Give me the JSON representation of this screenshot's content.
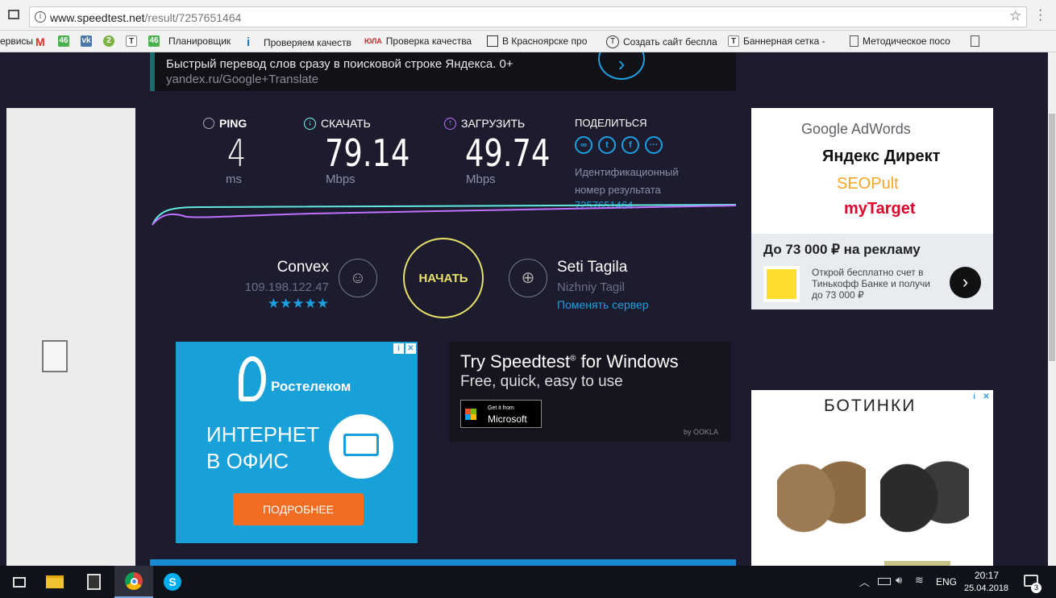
{
  "browser": {
    "url_host": "www.speedtest.net",
    "url_path": "/result/7257651464",
    "bookmarks": [
      {
        "label": "ервисы",
        "icon": "apps-icon"
      },
      {
        "label": "",
        "icon": "gmail-icon"
      },
      {
        "label": "",
        "icon": "badge-46-icon"
      },
      {
        "label": "",
        "icon": "vk-icon"
      },
      {
        "label": "",
        "icon": "2gis-icon"
      },
      {
        "label": "",
        "icon": "t-icon"
      },
      {
        "label": "",
        "icon": "badge-46-icon"
      },
      {
        "label": "Планировщик",
        "icon": ""
      },
      {
        "label": "Проверяем качеств",
        "icon": "info-icon"
      },
      {
        "label": "Проверка качества",
        "icon": "logo-icon"
      },
      {
        "label": "В Красноярске про",
        "icon": "doc-icon"
      },
      {
        "label": "Создать сайт беспла",
        "icon": "t-circle-icon"
      },
      {
        "label": "Баннерная сетка - ",
        "icon": "t-icon"
      },
      {
        "label": "Методическое посо",
        "icon": "page-icon"
      }
    ]
  },
  "top_ad": {
    "title": "Быстрый перевод слов сразу в поисковой строке Яндекса. 0+",
    "url": "yandex.ru/Google+Translate"
  },
  "results": {
    "ping": {
      "label": "PING",
      "value": "4",
      "unit": "ms"
    },
    "download": {
      "label": "СКАЧАТЬ",
      "value": "79.14",
      "unit": "Mbps"
    },
    "upload": {
      "label": "ЗАГРУЗИТЬ",
      "value": "49.74",
      "unit": "Mbps"
    },
    "share_label": "ПОДЕЛИТЬСЯ",
    "id_label_line1": "Идентификационный",
    "id_label_line2": "номер результата",
    "id_value": "7257651464"
  },
  "isp": {
    "name": "Convex",
    "ip": "109.198.122.47",
    "rating_stars": 5
  },
  "start_button": "НАЧАТЬ",
  "server": {
    "name": "Seti Tagila",
    "city": "Nizhniy Tagil",
    "change_link": "Поменять сервер"
  },
  "ad_rostelecom": {
    "brand": "Ростелеком",
    "line1": "ИНТЕРНЕТ",
    "line2": "В ОФИС",
    "button": "ПОДРОБНЕЕ"
  },
  "promo": {
    "title_a": "Try Speedtest",
    "title_sup": "®",
    "title_b": " for Windows",
    "subtitle": "Free, quick, easy to use",
    "store_small": "Get it from",
    "store_big": "Microsoft",
    "by": "by OOKLA"
  },
  "ad_google": {
    "brands": [
      "Google AdWords",
      "Яндекс Директ",
      "SEOPult",
      "myTarget"
    ],
    "headline": "До 73 000 ₽ на рекламу",
    "body": "Открой бесплатно счет в Тинькофф Банке и получи до 73 000 ₽"
  },
  "ad_shoes": {
    "title": "БОТИНКИ"
  },
  "taskbar": {
    "lang": "ENG",
    "time": "20:17",
    "date": "25.04.2018",
    "notifications": "3"
  },
  "colors": {
    "accent": "#1e9fe0",
    "bg": "#1c1c2e",
    "download": "#6afff3",
    "upload": "#bf71ff",
    "start": "#e8e06b"
  }
}
